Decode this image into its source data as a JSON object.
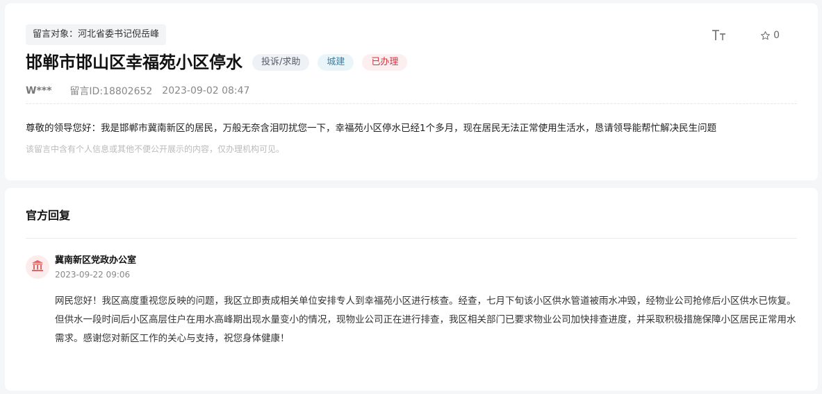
{
  "message": {
    "target": "留言对象：河北省委书记倪岳峰",
    "title": "邯郸市邯山区幸福苑小区停水",
    "tags": {
      "category": "投诉/求助",
      "type": "城建",
      "status": "已办理"
    },
    "user": "W***",
    "message_id": "留言ID:18802652",
    "datetime": "2023-09-02 08:47",
    "content": "尊敬的领导您好：我是邯郸市冀南新区的居民，万般无奈含泪叨扰您一下，幸福苑小区停水已经1个多月，现在居民无法正常使用生活水，恳请领导能帮忙解决民生问题",
    "privacy_note": "该留言中含有个人信息或其他不便公开展示的内容，仅办理机构可见。"
  },
  "toolbar": {
    "font_size_icon": "font-size-icon",
    "star_icon": "star-icon",
    "favorite_count": "0"
  },
  "reply": {
    "heading": "官方回复",
    "org_icon": "government-building-icon",
    "org_name": "冀南新区党政办公室",
    "datetime": "2023-09-22 09:06",
    "content": "网民您好！我区高度重视您反映的问题，我区立即责成相关单位安排专人到幸福苑小区进行核查。经查，七月下旬该小区供水管道被雨水冲毁，经物业公司抢修后小区供水已恢复。但供水一段时间后小区高层住户在用水高峰期出现水量变小的情况，现物业公司正在进行排查，我区相关部门已要求物业公司加快排查进度，并采取积极措施保障小区居民正常用水需求。感谢您对新区工作的关心与支持，祝您身体健康！"
  },
  "colors": {
    "status_red": "#d2343e",
    "type_blue": "#3d7fa3",
    "avatar_bg": "#fdecec",
    "avatar_icon": "#e06666"
  }
}
